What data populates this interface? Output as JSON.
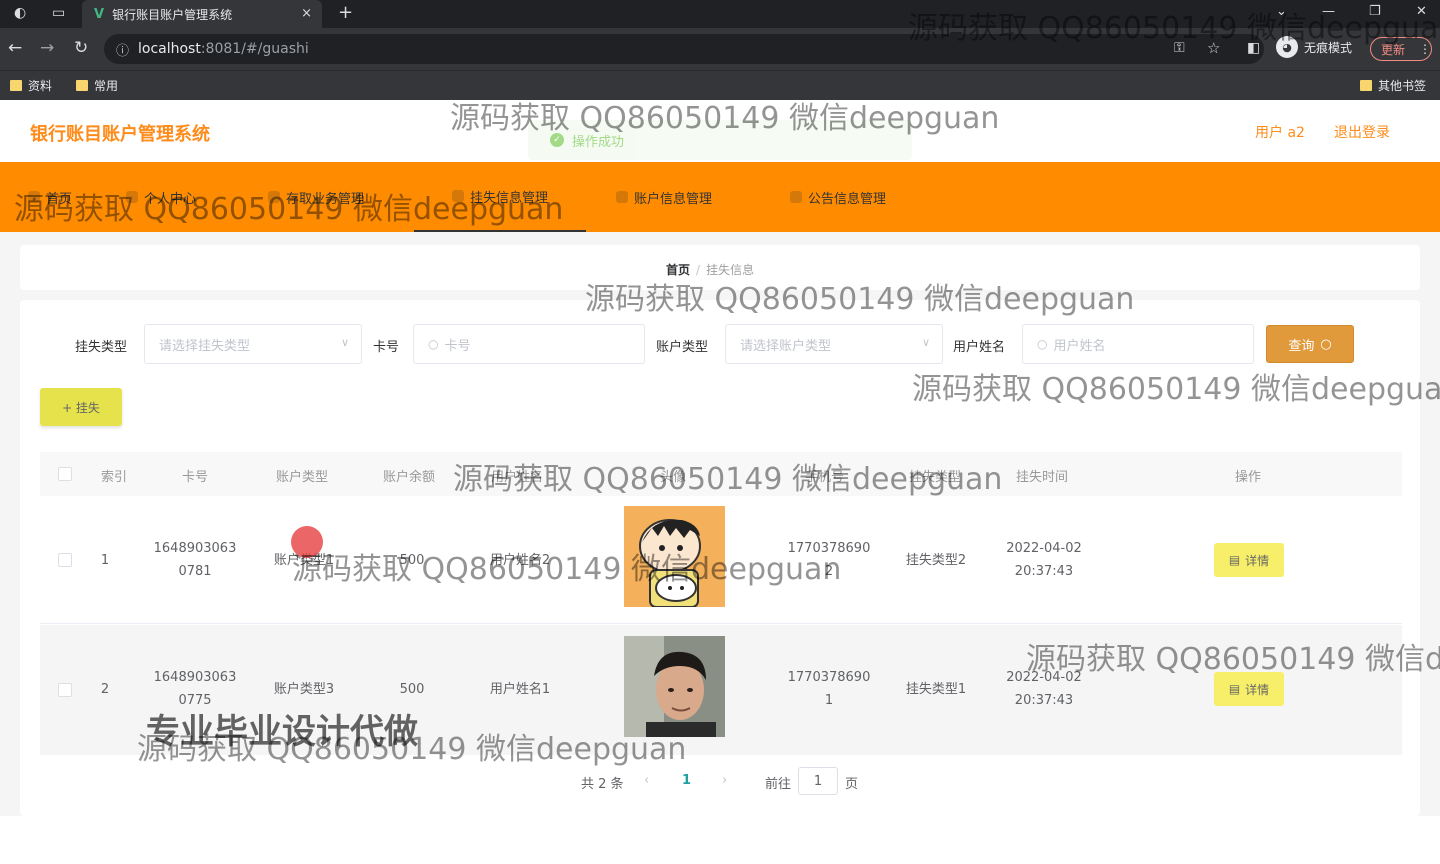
{
  "browser": {
    "tab_title": "银行账目账户管理系统",
    "tab_close": "×",
    "new_tab": "+",
    "url_host": "localhost",
    "url_rest": ":8081/#/guashi",
    "incognito_label": "无痕模式",
    "update_label": "更新",
    "bookmarks": [
      "资料",
      "常用"
    ],
    "other_bookmarks": "其他书签"
  },
  "header": {
    "title": "银行账目账户管理系统",
    "toast": "操作成功",
    "user_label": "用户 a2",
    "logout_label": "退出登录"
  },
  "nav": {
    "items": [
      "首页",
      "个人中心",
      "存取业务管理",
      "挂失信息管理",
      "账户信息管理",
      "公告信息管理"
    ]
  },
  "breadcrumb": {
    "home": "首页",
    "separator": "/",
    "current": "挂失信息"
  },
  "filters": {
    "loss_type_label": "挂失类型",
    "loss_type_placeholder": "请选择挂失类型",
    "card_label": "卡号",
    "card_placeholder": "卡号",
    "account_type_label": "账户类型",
    "account_type_placeholder": "请选择账户类型",
    "user_name_label": "用户姓名",
    "user_name_placeholder": "用户姓名",
    "search_label": "查询"
  },
  "actions": {
    "add_label": "+ 挂失"
  },
  "table": {
    "columns": [
      "索引",
      "卡号",
      "账户类型",
      "账户余额",
      "用户姓名",
      "头像",
      "手机号",
      "挂失类型",
      "挂失时间",
      "操作"
    ],
    "rows": [
      {
        "index": "1",
        "card_line1": "1648903063",
        "card_line2": "0781",
        "account_type": "账户类型1",
        "balance": "500",
        "user_name": "用户姓名2",
        "phone_line1": "1770378690",
        "phone_line2": "2",
        "loss_type": "挂失类型2",
        "time_line1": "2022-04-02",
        "time_line2": "20:37:43",
        "action": "详情"
      },
      {
        "index": "2",
        "card_line1": "1648903063",
        "card_line2": "0775",
        "account_type": "账户类型3",
        "balance": "500",
        "user_name": "用户姓名1",
        "phone_line1": "1770378690",
        "phone_line2": "1",
        "loss_type": "挂失类型1",
        "time_line1": "2022-04-02",
        "time_line2": "20:37:43",
        "action": "详情"
      }
    ]
  },
  "pagination": {
    "total": "共 2 条",
    "prev": "‹",
    "current_page": "1",
    "next": "›",
    "goto_label": "前往",
    "goto_value": "1",
    "page_suffix": "页"
  },
  "watermark": {
    "text": "源码获取 QQ86050149 微信deepguan",
    "promo": "专业毕业设计代做"
  },
  "colors": {
    "accent": "#ff8c00",
    "title": "#ff8c1a",
    "success": "#67c23a"
  }
}
